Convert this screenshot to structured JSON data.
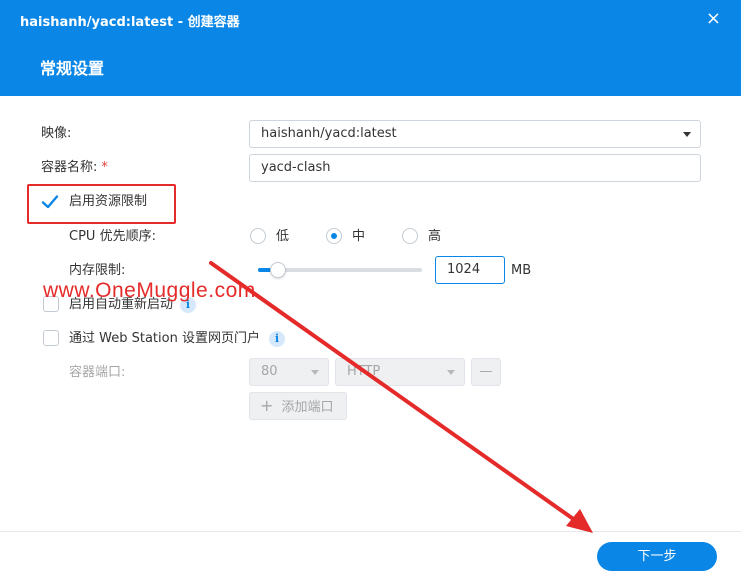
{
  "window": {
    "title": "haishanh/yacd:latest - 创建容器",
    "close_icon": "×"
  },
  "section": {
    "title": "常规设置"
  },
  "form": {
    "image_label": "映像:",
    "image_value": "haishanh/yacd:latest",
    "name_label": "容器名称:",
    "name_required": "*",
    "name_value": "yacd-clash",
    "resource_limit": {
      "label": "启用资源限制",
      "checked": true
    },
    "cpu_priority": {
      "label": "CPU 优先顺序:",
      "options": [
        "低",
        "中",
        "高"
      ],
      "selected": "中"
    },
    "memory_limit": {
      "label": "内存限制:",
      "value": "1024",
      "unit": "MB",
      "slider_fraction": 0.12
    },
    "auto_restart": {
      "label": "启用自动重新启动",
      "checked": false
    },
    "web_station": {
      "label": "通过 Web Station 设置网页门户",
      "checked": false
    },
    "container_port": {
      "label": "容器端口:",
      "port_value": "80",
      "protocol_value": "HTTP",
      "remove_symbol": "—",
      "add_label": "添加端口",
      "add_symbol": "+"
    },
    "info_symbol": "i"
  },
  "footer": {
    "next_label": "下一步"
  },
  "overlay": {
    "watermark": "www.OneMuggle.com"
  },
  "colors": {
    "accent": "#0a86e6",
    "annotation_red": "#e52a2a"
  }
}
